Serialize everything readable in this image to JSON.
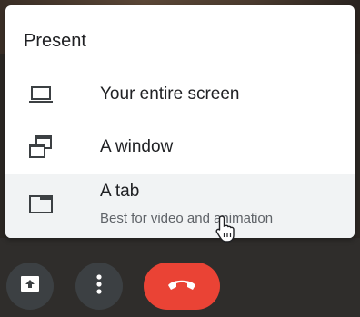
{
  "menu": {
    "title": "Present",
    "items": [
      {
        "label": "Your entire screen",
        "icon": "laptop-icon"
      },
      {
        "label": "A window",
        "icon": "window-icon"
      },
      {
        "label": "A tab",
        "sublabel": "Best for video and animation",
        "icon": "tab-icon"
      }
    ]
  },
  "controls": [
    {
      "icon": "present-screen-icon"
    },
    {
      "icon": "more-vertical-icon"
    },
    {
      "icon": "hang-up-icon",
      "color": "#ea4335"
    }
  ],
  "colors": {
    "accent_red": "#ea4335",
    "hover_bg": "#f1f3f4",
    "control_bg": "#3c4043"
  }
}
